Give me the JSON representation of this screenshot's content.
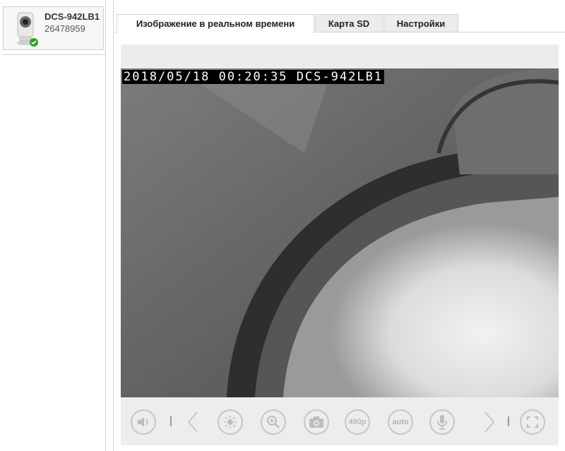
{
  "device": {
    "name": "DCS-942LB1",
    "serial": "26478959",
    "status_icon": "check-circle-icon",
    "status_color": "#2ca02c"
  },
  "tabs": [
    {
      "label": "Изображение в реальном времени",
      "active": true
    },
    {
      "label": "Карта SD",
      "active": false
    },
    {
      "label": "Настройки",
      "active": false
    }
  ],
  "video": {
    "osd_text": "2018/05/18  00:20:35  DCS-942LB1"
  },
  "controls": {
    "volume_icon": "speaker-icon",
    "prev_icon": "chevron-left-icon",
    "brightness_icon": "sun-icon",
    "zoom_icon": "zoom-in-icon",
    "snapshot_icon": "camera-icon",
    "resolution_label": "480p",
    "mode_label": "auto",
    "mic_icon": "microphone-icon",
    "next_icon": "chevron-right-icon",
    "fullscreen_icon": "fullscreen-icon"
  }
}
